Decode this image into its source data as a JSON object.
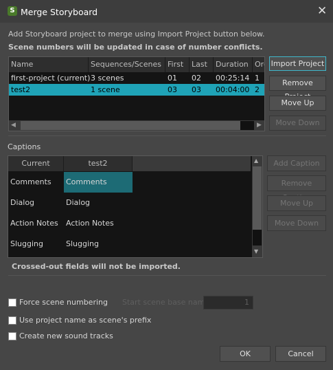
{
  "window": {
    "title": "Merge Storyboard",
    "close_label": "✕",
    "icon_letter": "S"
  },
  "intro": {
    "line1": "Add Storyboard project to merge using Import Project button below.",
    "line2": "Scene numbers will be updated in case of number conflicts."
  },
  "projects": {
    "columns": [
      "Name",
      "Sequences/Scenes",
      "First",
      "Last",
      "Duration",
      "Order"
    ],
    "rows": [
      {
        "name": "first-project (current)",
        "scenes": "3 scenes",
        "first": "01",
        "last": "02",
        "duration": "00:25:14",
        "order": "1",
        "selected": false
      },
      {
        "name": "test2",
        "scenes": "1 scene",
        "first": "03",
        "last": "03",
        "duration": "00:04:00",
        "order": "2",
        "selected": true
      }
    ],
    "buttons": {
      "import": "Import Project",
      "remove": "Remove Project",
      "up": "Move Up",
      "down": "Move Down"
    }
  },
  "captions": {
    "label": "Captions",
    "columns": [
      "Current",
      "test2"
    ],
    "rows": [
      [
        "Comments",
        "Comments"
      ],
      [
        "Dialog",
        "Dialog"
      ],
      [
        "Action Notes",
        "Action Notes"
      ],
      [
        "Slugging",
        "Slugging"
      ]
    ],
    "buttons": {
      "add": "Add Caption",
      "remove": "Remove Caption",
      "up": "Move Up",
      "down": "Move Down"
    },
    "note": "Crossed-out fields will not be imported."
  },
  "options": {
    "force": {
      "label": "Force scene numbering",
      "checked": false
    },
    "start_label": "Start scene base name",
    "start_value": "1",
    "prefix": {
      "label": "Use project name as scene's prefix",
      "checked": false
    },
    "sound": {
      "label": "Create new sound tracks",
      "checked": false
    }
  },
  "footer": {
    "ok": "OK",
    "cancel": "Cancel"
  }
}
